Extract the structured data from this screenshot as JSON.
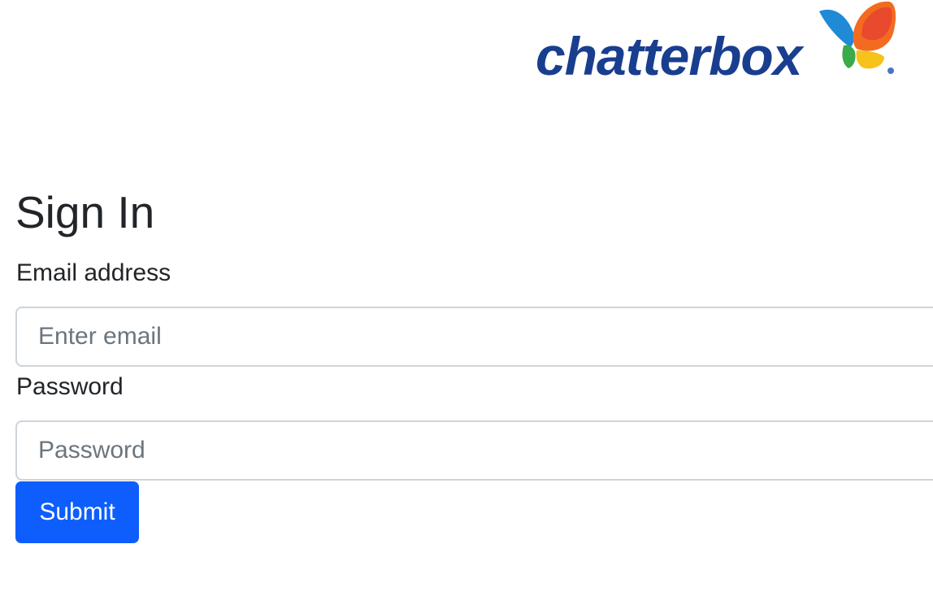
{
  "logo": {
    "text": "chatterbox",
    "icon": "butterfly-logo-icon",
    "colors": {
      "wordmark": "#1a3e8f",
      "wing_orange": "#f26b21",
      "wing_red": "#e8432e",
      "wing_blue": "#1f8ad6",
      "wing_green": "#3aab49",
      "wing_yellow": "#f7c21b"
    }
  },
  "form": {
    "title": "Sign In",
    "email_label": "Email address",
    "email_placeholder": "Enter email",
    "email_value": "",
    "password_label": "Password",
    "password_placeholder": "Password",
    "password_value": "",
    "submit_label": "Submit"
  },
  "colors": {
    "primary": "#0d5efd",
    "text": "#212529",
    "placeholder": "#6c757d",
    "input_border": "#ced4da"
  }
}
